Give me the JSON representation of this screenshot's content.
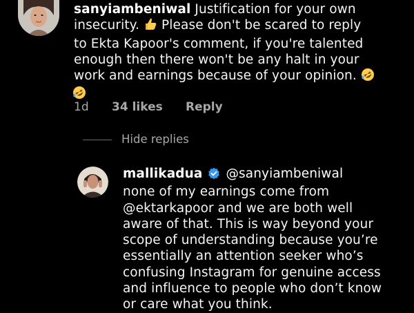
{
  "colors": {
    "background": "#000000",
    "text": "#f5f5f5",
    "meta": "#a8a8a8",
    "verified": "#3897f0"
  },
  "comment": {
    "username": "sanyiambeniwal",
    "lines": [
      "Justification for your own",
      "insecurity.",
      "Please don't be scared to reply",
      "to Ekta Kapoor's comment, if you're talented",
      "enough then there won't be any halt in your",
      "work and earnings because of your opinion."
    ],
    "emojis": [
      "thumbs-up-emoji",
      "rolling-laughing-emoji",
      "rolling-laughing-emoji"
    ],
    "time": "1d",
    "likes": "34 likes",
    "reply_label": "Reply"
  },
  "hide_replies": "Hide replies",
  "reply": {
    "username": "mallikadua",
    "mention": "@sanyiambeniwal",
    "lines": [
      "none of my earnings come from",
      "@ektarkapoor and we are both well",
      "aware of that. This is way beyond your",
      "scope of understanding because you’re",
      "essentially an attention seeker who’s",
      "confusing Instagram for genuine access",
      "and influence to people who don’t know",
      "or care what you think."
    ]
  }
}
